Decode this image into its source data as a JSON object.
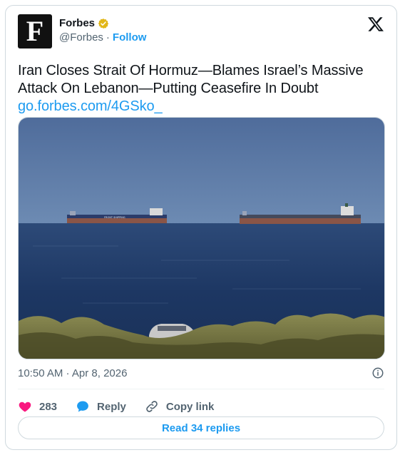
{
  "author": {
    "avatar_letter": "F",
    "name": "Forbes",
    "handle": "@Forbes",
    "separator": "·",
    "follow_label": "Follow",
    "verified_color": "#e2b719"
  },
  "tweet": {
    "text": "Iran Closes Strait Of Hormuz—Blames Israel’s Massive Attack On Lebanon—Putting Ceasefire In Doubt",
    "link": "go.forbes.com/4GSko_",
    "timestamp": "10:50 AM · Apr 8, 2026"
  },
  "media": {
    "description_icon": "photo-of-tankers-at-sea",
    "ship_label": "FRONT SHIPPING"
  },
  "actions": {
    "like_count": "283",
    "reply_label": "Reply",
    "copy_label": "Copy link"
  },
  "read_replies_label": "Read 34 replies",
  "colors": {
    "accent": "#1d9bf0",
    "like": "#f91880",
    "text_secondary": "#536471"
  }
}
